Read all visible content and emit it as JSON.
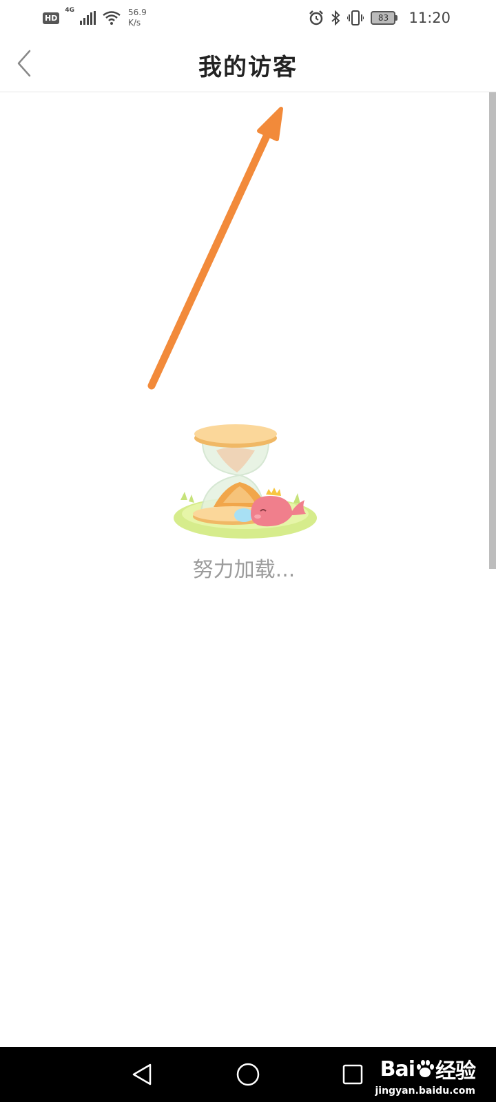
{
  "status_bar": {
    "hd": "HD",
    "network": "4G",
    "speed_value": "56.9",
    "speed_unit": "K/s",
    "battery": "83",
    "time": "11:20"
  },
  "header": {
    "title": "我的访客"
  },
  "loading": {
    "text": "努力加载..."
  },
  "watermark": {
    "logo_prefix": "Bai",
    "logo_suffix": "经验",
    "url": "jingyan.baidu.com"
  },
  "colors": {
    "annotation_arrow": "#f28a3a",
    "loading_text": "#9b9b9b",
    "scrollbar": "#bdbdbd"
  }
}
